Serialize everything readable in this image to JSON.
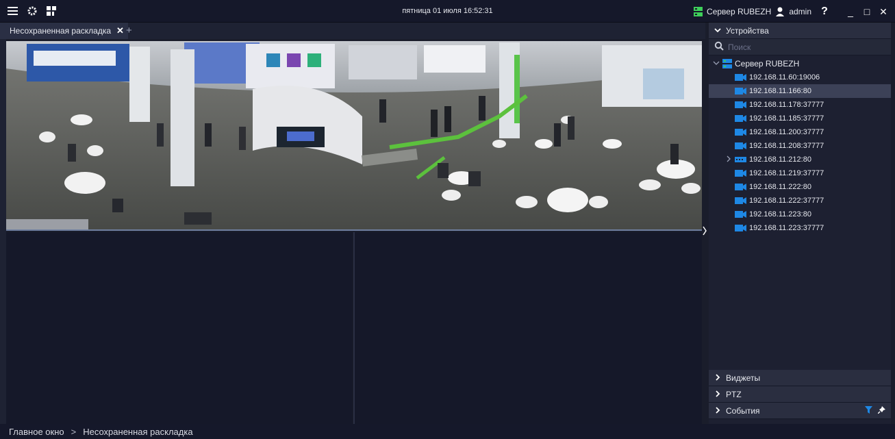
{
  "topbar": {
    "datetime": "пятница 01 июля 16:52:31",
    "server_label": "Сервер RUBEZH",
    "user": "admin",
    "help": "?",
    "minimize": "_",
    "maximize": "□",
    "close": "✕"
  },
  "tabs": {
    "active_label": "Несохраненная раскладка",
    "close": "✕",
    "add": "+"
  },
  "panel": {
    "devices_label": "Устройства",
    "search_placeholder": "Поиск",
    "server_name": "Сервер RUBEZH",
    "cameras": [
      {
        "label": "192.168.11.60:19006"
      },
      {
        "label": "192.168.11.166:80"
      },
      {
        "label": "192.168.11.178:37777"
      },
      {
        "label": "192.168.11.185:37777"
      },
      {
        "label": "192.168.11.200:37777"
      },
      {
        "label": "192.168.11.208:37777"
      },
      {
        "label": "192.168.11.212:80"
      },
      {
        "label": "192.168.11.219:37777"
      },
      {
        "label": "192.168.11.222:80"
      },
      {
        "label": "192.168.11.222:37777"
      },
      {
        "label": "192.168.11.223:80"
      },
      {
        "label": "192.168.11.223:37777"
      }
    ],
    "selected_camera": "192.168.11.166:80",
    "widgets_label": "Виджеты",
    "ptz_label": "PTZ",
    "events_label": "События"
  },
  "statusbar": {
    "crumb_root": "Главное окно",
    "crumb_sep": ">",
    "crumb_current": "Несохраненная раскладка"
  },
  "colors": {
    "accent_blue": "#1e88e5",
    "server_green": "#3ecf5a",
    "background": "#1a1d2b"
  }
}
